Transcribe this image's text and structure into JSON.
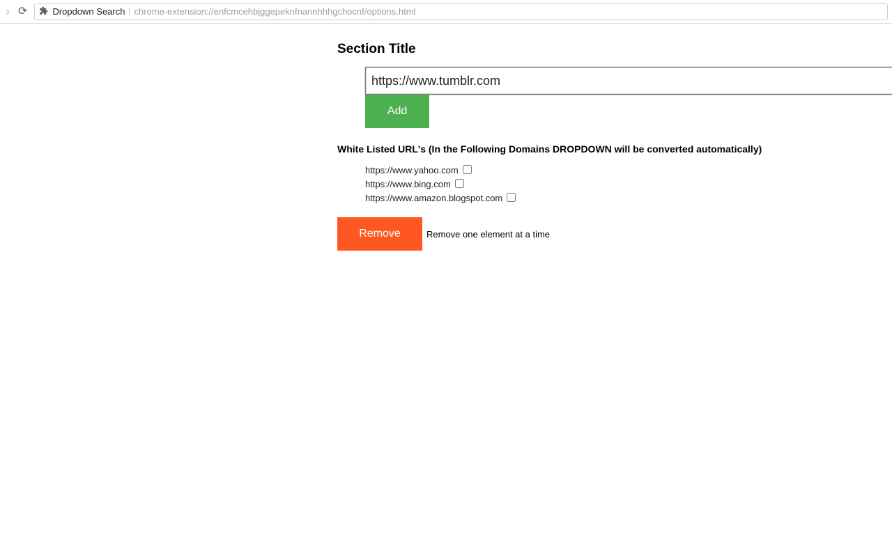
{
  "browser": {
    "extension_name": "Dropdown Search",
    "url": "chrome-extension://enfcmcehbjggepeknfnannhhhgchocnf/options.html"
  },
  "page": {
    "section_title": "Section Title",
    "input_value": "https://www.tumblr.com",
    "add_label": "Add",
    "subhead": "White Listed URL's (In the Following Domains DROPDOWN will be converted automatically)",
    "urls": [
      {
        "text": "https://www.yahoo.com",
        "checked": false
      },
      {
        "text": "https://www.bing.com",
        "checked": false
      },
      {
        "text": "https://www.amazon.blogspot.com",
        "checked": false
      }
    ],
    "remove_label": "Remove",
    "remove_hint": "Remove one element at a time"
  }
}
